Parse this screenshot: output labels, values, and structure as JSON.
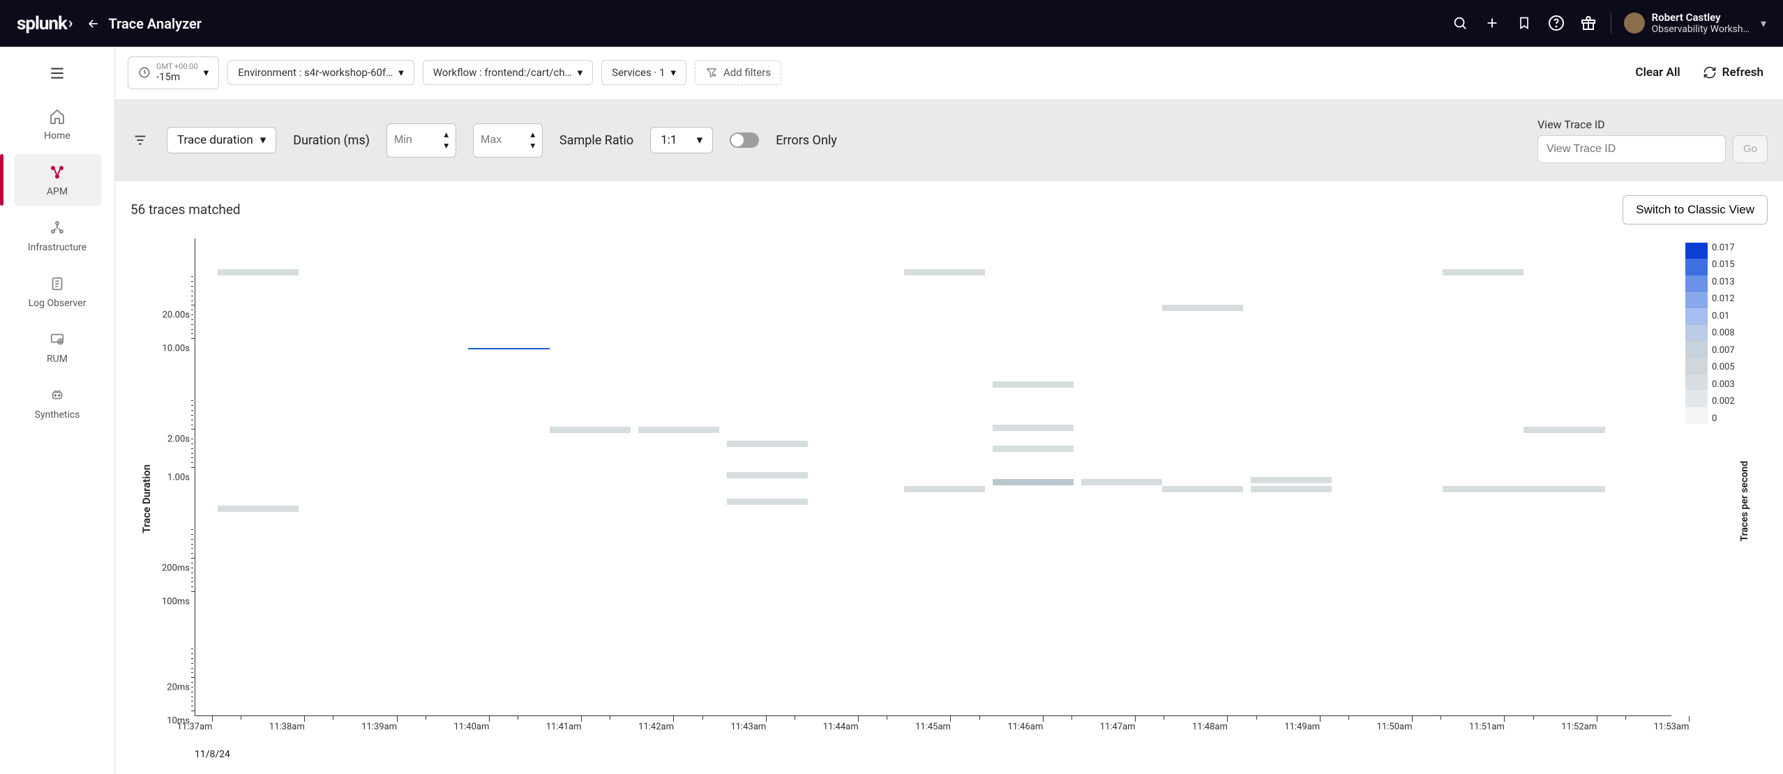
{
  "header": {
    "logo_text": "splunk",
    "page_title": "Trace Analyzer",
    "user_name": "Robert Castley",
    "user_org": "Observability Worksh…"
  },
  "sidebar": {
    "items": [
      {
        "label": "Home"
      },
      {
        "label": "APM"
      },
      {
        "label": "Infrastructure"
      },
      {
        "label": "Log Observer"
      },
      {
        "label": "RUM"
      },
      {
        "label": "Synthetics"
      }
    ]
  },
  "filters": {
    "time_zone": "GMT +00:00",
    "time_range": "-15m",
    "environment_label": "Environment : s4r-workshop-60f…",
    "workflow_label": "Workflow : frontend:/cart/ch…",
    "services_label": "Services · 1",
    "add_filters": "Add filters",
    "clear_all": "Clear All",
    "refresh": "Refresh"
  },
  "controls": {
    "trace_duration_label": "Trace duration",
    "duration_label": "Duration (ms)",
    "min_placeholder": "Min",
    "max_placeholder": "Max",
    "sample_ratio_label": "Sample Ratio",
    "sample_ratio_value": "1:1",
    "errors_only": "Errors Only",
    "view_trace_id_label": "View Trace ID",
    "view_trace_id_placeholder": "View Trace ID",
    "go": "Go"
  },
  "results": {
    "matched": "56 traces matched",
    "switch_view": "Switch to Classic View"
  },
  "chart_data": {
    "type": "heatmap",
    "ylabel": "Trace Duration",
    "y_ticks": [
      {
        "label": "20.00s",
        "pos": 0.86
      },
      {
        "label": "10.00s",
        "pos": 0.79
      },
      {
        "label": "2.00s",
        "pos": 0.6
      },
      {
        "label": "1.00s",
        "pos": 0.52
      },
      {
        "label": "200ms",
        "pos": 0.33
      },
      {
        "label": "100ms",
        "pos": 0.26
      },
      {
        "label": "20ms",
        "pos": 0.08
      },
      {
        "label": "10ms",
        "pos": 0.01
      }
    ],
    "x_ticks": [
      "11:37am",
      "11:38am",
      "11:39am",
      "11:40am",
      "11:41am",
      "11:42am",
      "11:43am",
      "11:44am",
      "11:45am",
      "11:46am",
      "11:47am",
      "11:48am",
      "11:49am",
      "11:50am",
      "11:51am",
      "11:52am",
      "11:53am"
    ],
    "x_date": "11/8/24",
    "cells": [
      {
        "x": 0.015,
        "y": 0.935,
        "w": 0.055,
        "shade": "light"
      },
      {
        "x": 0.015,
        "y": 0.44,
        "w": 0.055,
        "shade": "light"
      },
      {
        "x": 0.185,
        "y": 0.77,
        "w": 0.055,
        "shade": "blue"
      },
      {
        "x": 0.24,
        "y": 0.605,
        "w": 0.055,
        "shade": "light"
      },
      {
        "x": 0.3,
        "y": 0.605,
        "w": 0.055,
        "shade": "light"
      },
      {
        "x": 0.36,
        "y": 0.575,
        "w": 0.055,
        "shade": "light"
      },
      {
        "x": 0.36,
        "y": 0.51,
        "w": 0.055,
        "shade": "light"
      },
      {
        "x": 0.36,
        "y": 0.455,
        "w": 0.055,
        "shade": "light"
      },
      {
        "x": 0.48,
        "y": 0.935,
        "w": 0.055,
        "shade": "light"
      },
      {
        "x": 0.48,
        "y": 0.48,
        "w": 0.055,
        "shade": "light"
      },
      {
        "x": 0.54,
        "y": 0.7,
        "w": 0.055,
        "shade": "light"
      },
      {
        "x": 0.54,
        "y": 0.61,
        "w": 0.055,
        "shade": "light"
      },
      {
        "x": 0.54,
        "y": 0.565,
        "w": 0.055,
        "shade": "light"
      },
      {
        "x": 0.54,
        "y": 0.495,
        "w": 0.055,
        "shade": "mid"
      },
      {
        "x": 0.6,
        "y": 0.495,
        "w": 0.055,
        "shade": "light"
      },
      {
        "x": 0.655,
        "y": 0.86,
        "w": 0.055,
        "shade": "light"
      },
      {
        "x": 0.655,
        "y": 0.48,
        "w": 0.055,
        "shade": "light"
      },
      {
        "x": 0.715,
        "y": 0.48,
        "w": 0.055,
        "shade": "light"
      },
      {
        "x": 0.715,
        "y": 0.5,
        "w": 0.055,
        "shade": "light"
      },
      {
        "x": 0.845,
        "y": 0.935,
        "w": 0.055,
        "shade": "light"
      },
      {
        "x": 0.845,
        "y": 0.48,
        "w": 0.055,
        "shade": "light"
      },
      {
        "x": 0.9,
        "y": 0.605,
        "w": 0.055,
        "shade": "light"
      },
      {
        "x": 0.9,
        "y": 0.48,
        "w": 0.055,
        "shade": "light"
      }
    ],
    "legend": {
      "title": "Traces per second",
      "labels": [
        "0.017",
        "0.015",
        "0.013",
        "0.012",
        "0.01",
        "0.008",
        "0.007",
        "0.005",
        "0.003",
        "0.002",
        "0"
      ],
      "colors": [
        "#0b3fd6",
        "#3e6fe0",
        "#6a92e8",
        "#8aa9ec",
        "#a6bef0",
        "#bccbe6",
        "#c7d2db",
        "#d0d7dc",
        "#d8dee1",
        "#e4e7e9",
        "#f4f5f6"
      ]
    }
  }
}
